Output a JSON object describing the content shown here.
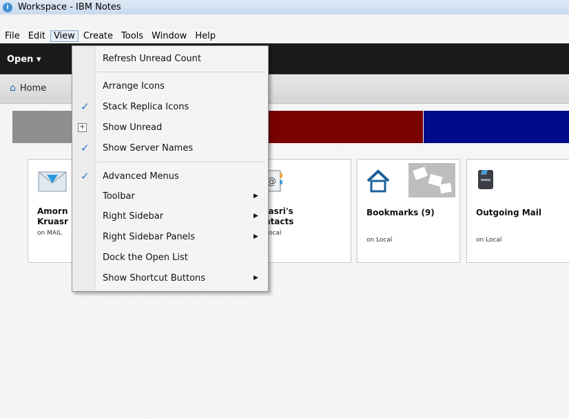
{
  "window": {
    "title": "Workspace - IBM Notes"
  },
  "menubar": {
    "items": [
      "File",
      "Edit",
      "View",
      "Create",
      "Tools",
      "Window",
      "Help"
    ],
    "active": "View"
  },
  "toolbar": {
    "open_label": "Open ▾"
  },
  "tabs": {
    "home_label": "Home"
  },
  "view_menu": {
    "items": [
      {
        "label": "Refresh Unread Count",
        "checked": false,
        "submenu": false
      },
      {
        "label": "Arrange Icons",
        "checked": false,
        "submenu": false
      },
      {
        "label": "Stack Replica Icons",
        "checked": true,
        "submenu": false
      },
      {
        "label": "Show Unread",
        "checked": false,
        "submenu": false,
        "icon": "show-unread-icon"
      },
      {
        "label": "Show Server Names",
        "checked": true,
        "submenu": false
      },
      {
        "label": "Advanced Menus",
        "checked": true,
        "submenu": false
      },
      {
        "label": "Toolbar",
        "checked": false,
        "submenu": true
      },
      {
        "label": "Right Sidebar",
        "checked": false,
        "submenu": true
      },
      {
        "label": "Right Sidebar Panels",
        "checked": false,
        "submenu": true
      },
      {
        "label": "Dock the Open List",
        "checked": false,
        "submenu": false
      },
      {
        "label": "Show Shortcut Buttons",
        "checked": false,
        "submenu": true
      }
    ]
  },
  "workspace": {
    "bands": [
      "#8f8f8f",
      "#7b0000",
      "#000b8a"
    ],
    "cards": [
      {
        "name_line1": "Amorn",
        "name_line2": "Kruasr",
        "location": "on MAIL"
      },
      {
        "name_line1": "uasri's",
        "name_line2": "ntacts",
        "location": "Local"
      },
      {
        "name_line1": "Bookmarks (9)",
        "name_line2": "",
        "location": "on Local"
      },
      {
        "name_line1": "Outgoing Mail",
        "name_line2": "",
        "location": "on Local"
      }
    ]
  },
  "colors": {
    "accent_check": "#2a6fc9",
    "openbar": "#1b1b1b"
  }
}
